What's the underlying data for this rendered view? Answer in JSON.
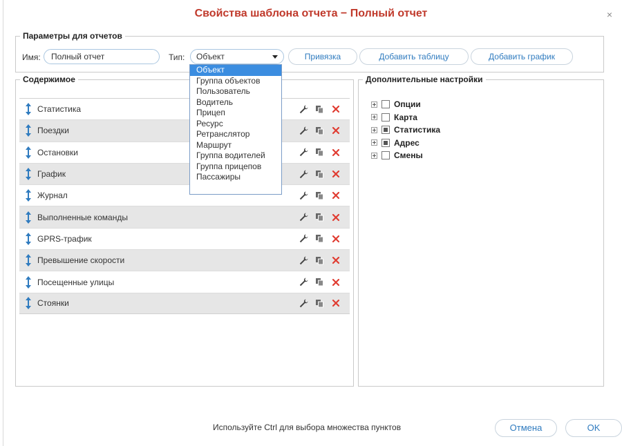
{
  "dialog": {
    "title": "Свойства шаблона отчета − Полный отчет",
    "close": "×"
  },
  "params": {
    "legend": "Параметры для отчетов",
    "name_label": "Имя:",
    "name_value": "Полный отчет",
    "type_label": "Тип:",
    "type_value": "Объект",
    "bind_button": "Привязка",
    "add_table_button": "Добавить таблицу",
    "add_chart_button": "Добавить график"
  },
  "type_dropdown": {
    "options": [
      "Объект",
      "Группа объектов",
      "Пользователь",
      "Водитель",
      "Прицеп",
      "Ресурс",
      "Ретранслятор",
      "Маршрут",
      "Группа водителей",
      "Группа прицепов",
      "Пассажиры"
    ],
    "selected_index": 0
  },
  "content": {
    "legend": "Содержимое",
    "rows": [
      "Статистика",
      "Поездки",
      "Остановки",
      "График",
      "Журнал",
      "Выполненные команды",
      "GPRS-трафик",
      "Превышение скорости",
      "Посещенные улицы",
      "Стоянки"
    ]
  },
  "extra": {
    "legend": "Дополнительные настройки",
    "items": [
      {
        "label": "Опции",
        "state": "unchecked"
      },
      {
        "label": "Карта",
        "state": "unchecked"
      },
      {
        "label": "Статистика",
        "state": "partial"
      },
      {
        "label": "Адрес",
        "state": "partial"
      },
      {
        "label": "Смены",
        "state": "unchecked"
      }
    ]
  },
  "footer": {
    "hint": "Используйте Ctrl для выбора множества пунктов",
    "cancel": "Отмена",
    "ok": "OK"
  },
  "colors": {
    "title": "#c0392b",
    "accent": "#2f7bbf",
    "delete": "#e03c31",
    "selected": "#3b8de0"
  }
}
